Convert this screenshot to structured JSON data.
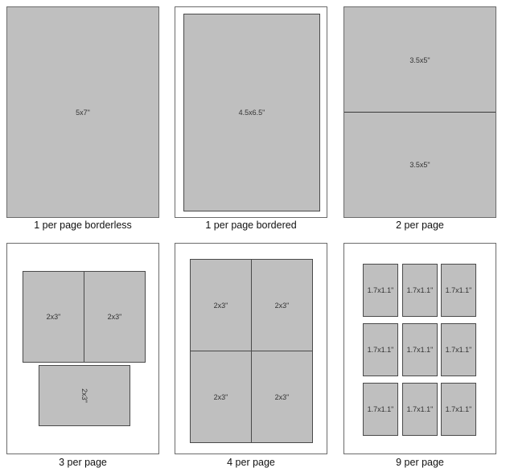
{
  "layouts": [
    {
      "caption": "1 per page borderless",
      "photos": [
        "5x7\""
      ]
    },
    {
      "caption": "1 per page bordered",
      "photos": [
        "4.5x6.5\""
      ]
    },
    {
      "caption": "2 per page",
      "photos": [
        "3.5x5\"",
        "3.5x5\""
      ]
    },
    {
      "caption": "3 per page",
      "photos": [
        "2x3\"",
        "2x3\"",
        "2x3\""
      ]
    },
    {
      "caption": "4 per page",
      "photos": [
        "2x3\"",
        "2x3\"",
        "2x3\"",
        "2x3\""
      ]
    },
    {
      "caption": "9 per page",
      "photos": [
        "1.7x1.1\"",
        "1.7x1.1\"",
        "1.7x1.1\"",
        "1.7x1.1\"",
        "1.7x1.1\"",
        "1.7x1.1\"",
        "1.7x1.1\"",
        "1.7x1.1\"",
        "1.7x1.1\""
      ]
    }
  ]
}
